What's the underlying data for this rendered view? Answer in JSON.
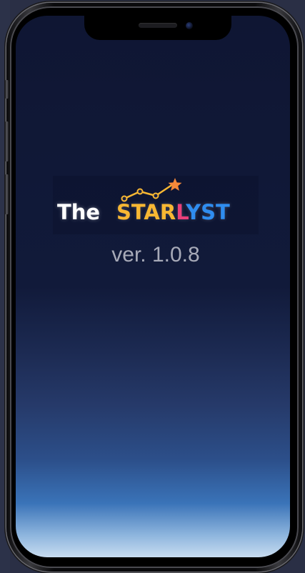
{
  "app": {
    "logo_prefix": "The",
    "logo_word": {
      "part1": "STAR",
      "part2": "L",
      "part3": "Y",
      "part4": "ST"
    },
    "version": "ver. 1.0.8"
  },
  "colors": {
    "logo_yellow": "#f7b733",
    "logo_pink": "#e9407a",
    "logo_blue": "#2f8df0",
    "screen_top": "#0f1633",
    "screen_bottom": "#c8dcf0"
  },
  "icons": {
    "logo_mark": "constellation-star-icon"
  }
}
